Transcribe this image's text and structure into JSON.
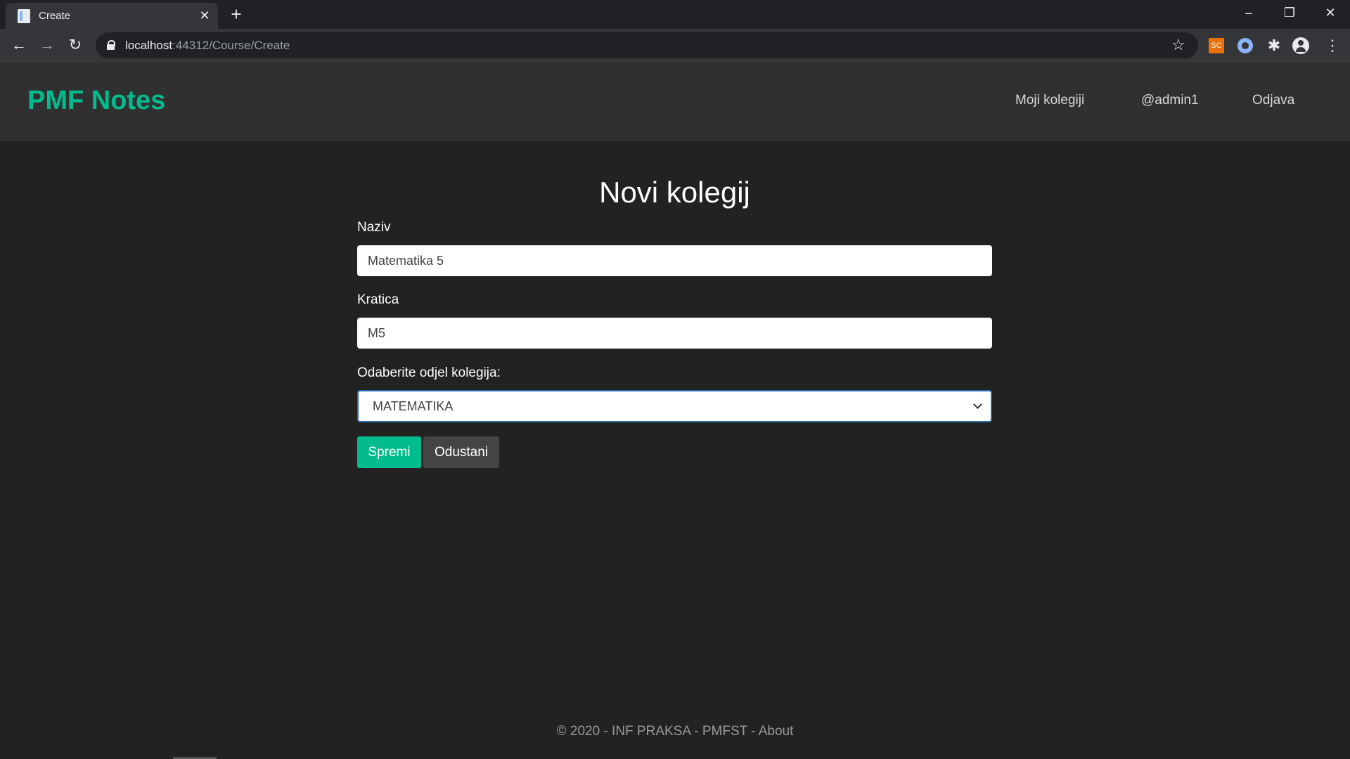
{
  "browser": {
    "tab_title": "Create",
    "new_tab": "+",
    "url_host": "localhost",
    "url_rest": ":44312/Course/Create",
    "ext_sc": "SC",
    "icons": [
      "page-icon",
      "close-icon",
      "plus-icon",
      "back-icon",
      "forward-icon",
      "reload-icon",
      "lock-icon",
      "star-icon",
      "puzzle-icon",
      "profile-icon",
      "menu-icon"
    ]
  },
  "navbar": {
    "brand": "PMF Notes",
    "links": [
      "Moji kolegiji",
      "@admin1",
      "Odjava"
    ]
  },
  "form": {
    "title": "Novi kolegij",
    "naziv_label": "Naziv",
    "naziv_value": "Matematika 5",
    "kratica_label": "Kratica",
    "kratica_value": "M5",
    "odjel_label": "Odaberite odjel kolegija:",
    "odjel_selected": "MATEMATIKA",
    "save_label": "Spremi",
    "cancel_label": "Odustani"
  },
  "footer": {
    "text": "© 2020 - INF PRAKSA - PMFST - ",
    "about": "About"
  },
  "colors": {
    "accent": "#00bc8c",
    "background": "#222222",
    "navbar": "#303030",
    "cancel": "#444444"
  }
}
